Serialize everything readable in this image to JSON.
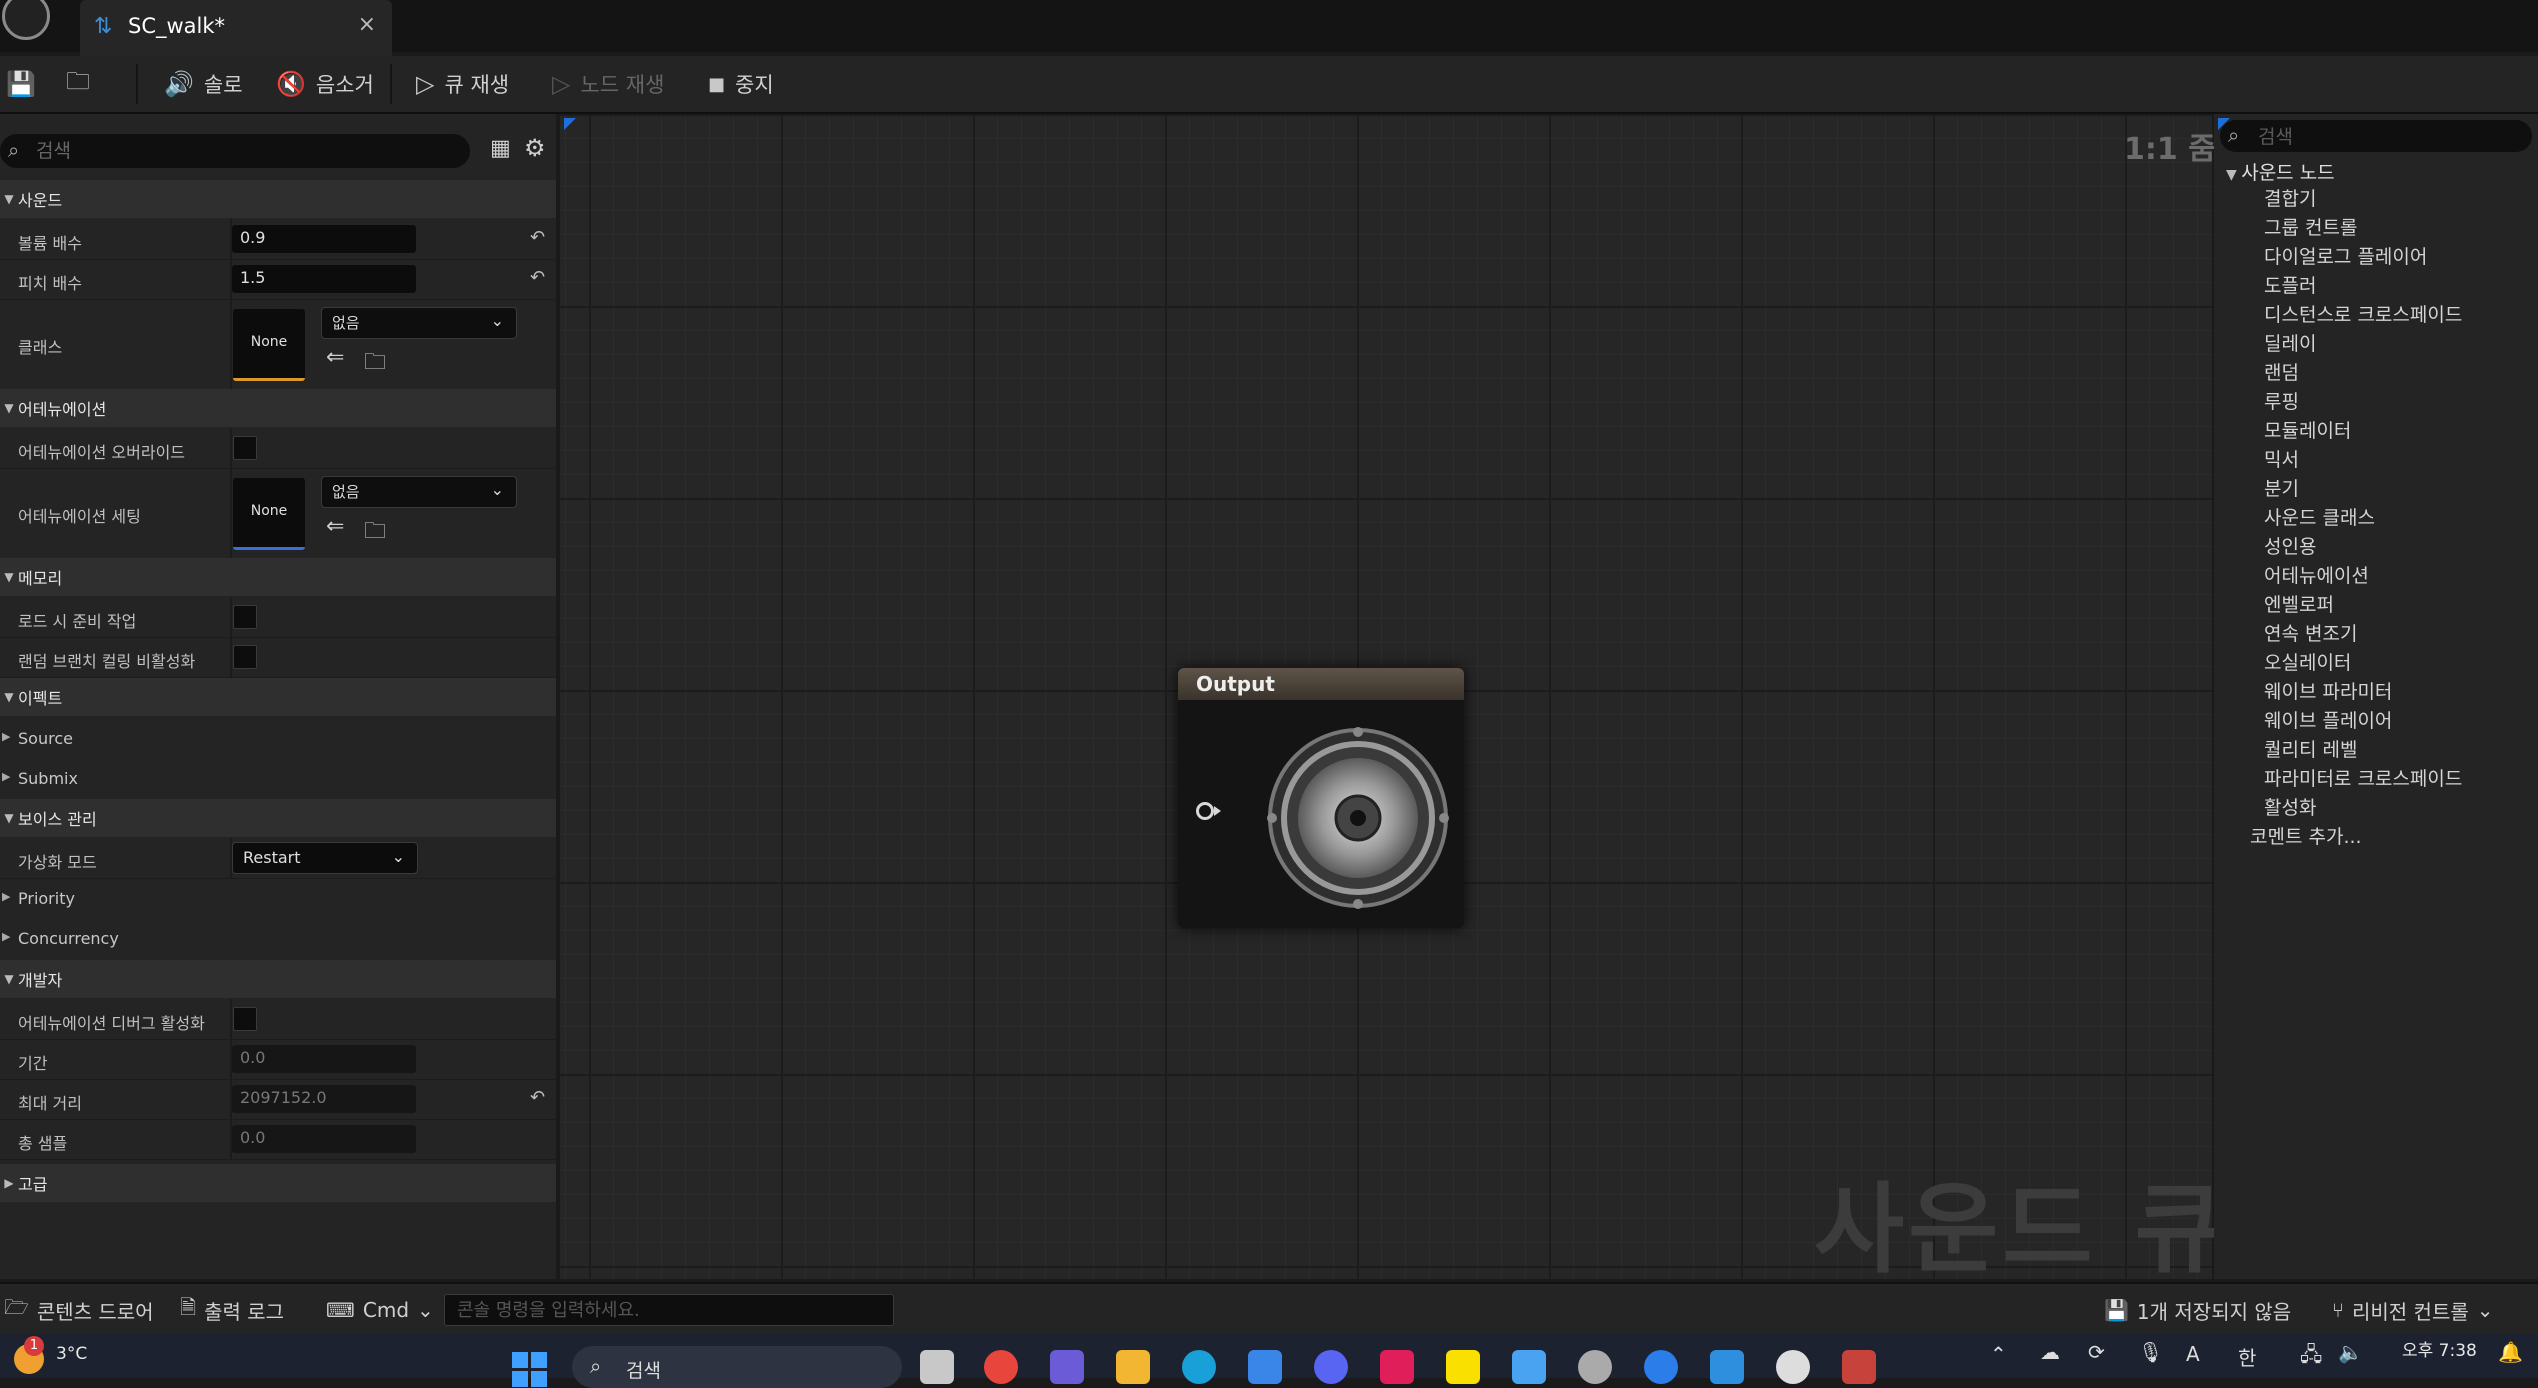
{
  "window": {
    "tab_title": "SC_walk*",
    "tab_close": "×"
  },
  "toolbar": {
    "solo": "솔로",
    "mute": "음소거",
    "play_cue": "큐 재생",
    "play_node": "노드 재생",
    "stop": "중지"
  },
  "details": {
    "search_placeholder": "검색",
    "sections": {
      "sound": "사운드",
      "attenuation": "어테뉴에이션",
      "memory": "메모리",
      "effects": "이펙트",
      "voice": "보이스 관리",
      "developer": "개발자",
      "advanced": "고급"
    },
    "volume_multiplier": {
      "label": "볼륨 배수",
      "value": "0.9"
    },
    "pitch_multiplier": {
      "label": "피치 배수",
      "value": "1.5"
    },
    "sound_class": {
      "label": "클래스",
      "thumb": "None",
      "combo": "없음"
    },
    "attenuation_override": {
      "label": "어테뉴에이션 오버라이드"
    },
    "attenuation_settings": {
      "label": "어테뉴에이션 세팅",
      "thumb": "None",
      "combo": "없음"
    },
    "prime_on_load": {
      "label": "로드 시 준비 작업"
    },
    "disable_random_branch_culling": {
      "label": "랜덤 브랜치 컬링 비활성화"
    },
    "source": "Source",
    "submix": "Submix",
    "virtualization_mode": {
      "label": "가상화 모드",
      "value": "Restart"
    },
    "priority": "Priority",
    "concurrency": "Concurrency",
    "debug_attenuation": {
      "label": "어테뉴에이션 디버그 활성화"
    },
    "duration": {
      "label": "기간",
      "value": "0.0"
    },
    "max_distance": {
      "label": "최대 거리",
      "value": "2097152.0"
    },
    "total_samples": {
      "label": "총 샘플",
      "value": "0.0"
    }
  },
  "graph": {
    "zoom": "1:1 줌",
    "watermark": "사운드 큐",
    "output_node_title": "Output"
  },
  "palette": {
    "search_placeholder": "검색",
    "category": "사운드 노드",
    "items": [
      "결합기",
      "그룹 컨트롤",
      "다이얼로그 플레이어",
      "도플러",
      "디스턴스로 크로스페이드",
      "딜레이",
      "랜덤",
      "루핑",
      "모듈레이터",
      "믹서",
      "분기",
      "사운드 클래스",
      "성인용",
      "어테뉴에이션",
      "엔벨로퍼",
      "연속 변조기",
      "오실레이터",
      "웨이브 파라미터",
      "웨이브 플레이어",
      "퀄리티 레벨",
      "파라미터로 크로스페이드",
      "활성화"
    ],
    "add_comment": "코멘트 추가..."
  },
  "bottombar": {
    "content_drawer": "콘텐츠 드로어",
    "output_log": "출력 로그",
    "cmd": "Cmd",
    "console_placeholder": "콘솔 명령을 입력하세요.",
    "unsaved": "1개 저장되지 않음",
    "revision_control": "리비전 컨트롤"
  },
  "taskbar": {
    "weather_temp": "3°C",
    "notification_count": "1",
    "search": "검색",
    "ime": "한",
    "ime2": "A",
    "time": "오후 7:38"
  },
  "colors": {
    "accent_blue": "#1e6fd9",
    "sound_class_underline": "#d89a2b",
    "attenuation_underline": "#3b6fd8"
  }
}
